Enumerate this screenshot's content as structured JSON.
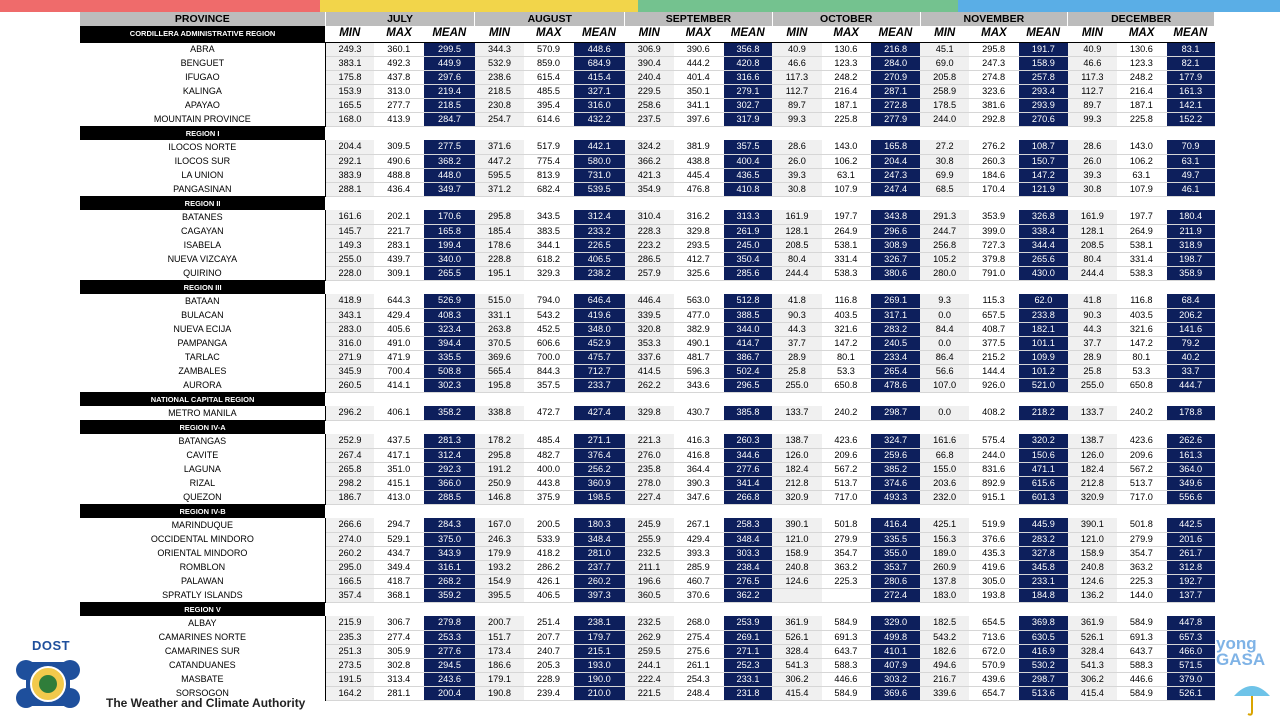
{
  "colors": {
    "top_bar": [
      "#ef6b6b",
      "#f2d54a",
      "#74c28f",
      "#5aaee6"
    ],
    "header_gray": "#bcbcbc",
    "mean_fill": "#0d1f5c",
    "region_fill": "#000000"
  },
  "header": {
    "province": "PROVINCE",
    "months": [
      "JULY",
      "AUGUST",
      "SEPTEMBER",
      "OCTOBER",
      "NOVEMBER",
      "DECEMBER"
    ],
    "sub": [
      "MIN",
      "MAX",
      "MEAN"
    ]
  },
  "footer": {
    "dost": "DOST",
    "tagline": "The Weather and Climate Authority",
    "pagasa_1": "yong",
    "pagasa_2": "GASA"
  },
  "regions": [
    {
      "name": "CORDILLERA ADMINISTRATIVE REGION",
      "provinces": [
        {
          "name": "ABRA",
          "v": [
            "249.3",
            "360.1",
            "299.5",
            "344.3",
            "570.9",
            "448.6",
            "306.9",
            "390.6",
            "356.8",
            "40.9",
            "130.6",
            "216.8",
            "45.1",
            "295.8",
            "191.7",
            "40.9",
            "130.6",
            "83.1"
          ]
        },
        {
          "name": "BENGUET",
          "v": [
            "383.1",
            "492.3",
            "449.9",
            "532.9",
            "859.0",
            "684.9",
            "390.4",
            "444.2",
            "420.8",
            "46.6",
            "123.3",
            "284.0",
            "69.0",
            "247.3",
            "158.9",
            "46.6",
            "123.3",
            "82.1"
          ]
        },
        {
          "name": "IFUGAO",
          "v": [
            "175.8",
            "437.8",
            "297.6",
            "238.6",
            "615.4",
            "415.4",
            "240.4",
            "401.4",
            "316.6",
            "117.3",
            "248.2",
            "270.9",
            "205.8",
            "274.8",
            "257.8",
            "117.3",
            "248.2",
            "177.9"
          ]
        },
        {
          "name": "KALINGA",
          "v": [
            "153.9",
            "313.0",
            "219.4",
            "218.5",
            "485.5",
            "327.1",
            "229.5",
            "350.1",
            "279.1",
            "112.7",
            "216.4",
            "287.1",
            "258.9",
            "323.6",
            "293.4",
            "112.7",
            "216.4",
            "161.3"
          ]
        },
        {
          "name": "APAYAO",
          "v": [
            "165.5",
            "277.7",
            "218.5",
            "230.8",
            "395.4",
            "316.0",
            "258.6",
            "341.1",
            "302.7",
            "89.7",
            "187.1",
            "272.8",
            "178.5",
            "381.6",
            "293.9",
            "89.7",
            "187.1",
            "142.1"
          ]
        },
        {
          "name": "MOUNTAIN PROVINCE",
          "v": [
            "168.0",
            "413.9",
            "284.7",
            "254.7",
            "614.6",
            "432.2",
            "237.5",
            "397.6",
            "317.9",
            "99.3",
            "225.8",
            "277.9",
            "244.0",
            "292.8",
            "270.6",
            "99.3",
            "225.8",
            "152.2"
          ]
        }
      ]
    },
    {
      "name": "REGION I",
      "provinces": [
        {
          "name": "ILOCOS NORTE",
          "v": [
            "204.4",
            "309.5",
            "277.5",
            "371.6",
            "517.9",
            "442.1",
            "324.2",
            "381.9",
            "357.5",
            "28.6",
            "143.0",
            "165.8",
            "27.2",
            "276.2",
            "108.7",
            "28.6",
            "143.0",
            "70.9"
          ]
        },
        {
          "name": "ILOCOS SUR",
          "v": [
            "292.1",
            "490.6",
            "368.2",
            "447.2",
            "775.4",
            "580.0",
            "366.2",
            "438.8",
            "400.4",
            "26.0",
            "106.2",
            "204.4",
            "30.8",
            "260.3",
            "150.7",
            "26.0",
            "106.2",
            "63.1"
          ]
        },
        {
          "name": "LA UNION",
          "v": [
            "383.9",
            "488.8",
            "448.0",
            "595.5",
            "813.9",
            "731.0",
            "421.3",
            "445.4",
            "436.5",
            "39.3",
            "63.1",
            "247.3",
            "69.9",
            "184.6",
            "147.2",
            "39.3",
            "63.1",
            "49.7"
          ]
        },
        {
          "name": "PANGASINAN",
          "v": [
            "288.1",
            "436.4",
            "349.7",
            "371.2",
            "682.4",
            "539.5",
            "354.9",
            "476.8",
            "410.8",
            "30.8",
            "107.9",
            "247.4",
            "68.5",
            "170.4",
            "121.9",
            "30.8",
            "107.9",
            "46.1"
          ]
        }
      ]
    },
    {
      "name": "REGION II",
      "provinces": [
        {
          "name": "BATANES",
          "v": [
            "161.6",
            "202.1",
            "170.6",
            "295.8",
            "343.5",
            "312.4",
            "310.4",
            "316.2",
            "313.3",
            "161.9",
            "197.7",
            "343.8",
            "291.3",
            "353.9",
            "326.8",
            "161.9",
            "197.7",
            "180.4"
          ]
        },
        {
          "name": "CAGAYAN",
          "v": [
            "145.7",
            "221.7",
            "165.8",
            "185.4",
            "383.5",
            "233.2",
            "228.3",
            "329.8",
            "261.9",
            "128.1",
            "264.9",
            "296.6",
            "244.7",
            "399.0",
            "338.4",
            "128.1",
            "264.9",
            "211.9"
          ]
        },
        {
          "name": "ISABELA",
          "v": [
            "149.3",
            "283.1",
            "199.4",
            "178.6",
            "344.1",
            "226.5",
            "223.2",
            "293.5",
            "245.0",
            "208.5",
            "538.1",
            "308.9",
            "256.8",
            "727.3",
            "344.4",
            "208.5",
            "538.1",
            "318.9"
          ]
        },
        {
          "name": "NUEVA VIZCAYA",
          "v": [
            "255.0",
            "439.7",
            "340.0",
            "228.8",
            "618.2",
            "406.5",
            "286.5",
            "412.7",
            "350.4",
            "80.4",
            "331.4",
            "326.7",
            "105.2",
            "379.8",
            "265.6",
            "80.4",
            "331.4",
            "198.7"
          ]
        },
        {
          "name": "QUIRINO",
          "v": [
            "228.0",
            "309.1",
            "265.5",
            "195.1",
            "329.3",
            "238.2",
            "257.9",
            "325.6",
            "285.6",
            "244.4",
            "538.3",
            "380.6",
            "280.0",
            "791.0",
            "430.0",
            "244.4",
            "538.3",
            "358.9"
          ]
        }
      ]
    },
    {
      "name": "REGION III",
      "provinces": [
        {
          "name": "BATAAN",
          "v": [
            "418.9",
            "644.3",
            "526.9",
            "515.0",
            "794.0",
            "646.4",
            "446.4",
            "563.0",
            "512.8",
            "41.8",
            "116.8",
            "269.1",
            "9.3",
            "115.3",
            "62.0",
            "41.8",
            "116.8",
            "68.4"
          ]
        },
        {
          "name": "BULACAN",
          "v": [
            "343.1",
            "429.4",
            "408.3",
            "331.1",
            "543.2",
            "419.6",
            "339.5",
            "477.0",
            "388.5",
            "90.3",
            "403.5",
            "317.1",
            "0.0",
            "657.5",
            "233.8",
            "90.3",
            "403.5",
            "206.2"
          ]
        },
        {
          "name": "NUEVA ECIJA",
          "v": [
            "283.0",
            "405.6",
            "323.4",
            "263.8",
            "452.5",
            "348.0",
            "320.8",
            "382.9",
            "344.0",
            "44.3",
            "321.6",
            "283.2",
            "84.4",
            "408.7",
            "182.1",
            "44.3",
            "321.6",
            "141.6"
          ]
        },
        {
          "name": "PAMPANGA",
          "v": [
            "316.0",
            "491.0",
            "394.4",
            "370.5",
            "606.6",
            "452.9",
            "353.3",
            "490.1",
            "414.7",
            "37.7",
            "147.2",
            "240.5",
            "0.0",
            "377.5",
            "101.1",
            "37.7",
            "147.2",
            "79.2"
          ]
        },
        {
          "name": "TARLAC",
          "v": [
            "271.9",
            "471.9",
            "335.5",
            "369.6",
            "700.0",
            "475.7",
            "337.6",
            "481.7",
            "386.7",
            "28.9",
            "80.1",
            "233.4",
            "86.4",
            "215.2",
            "109.9",
            "28.9",
            "80.1",
            "40.2"
          ]
        },
        {
          "name": "ZAMBALES",
          "v": [
            "345.9",
            "700.4",
            "508.8",
            "565.4",
            "844.3",
            "712.7",
            "414.5",
            "596.3",
            "502.4",
            "25.8",
            "53.3",
            "265.4",
            "56.6",
            "144.4",
            "101.2",
            "25.8",
            "53.3",
            "33.7"
          ]
        },
        {
          "name": "AURORA",
          "v": [
            "260.5",
            "414.1",
            "302.3",
            "195.8",
            "357.5",
            "233.7",
            "262.2",
            "343.6",
            "296.5",
            "255.0",
            "650.8",
            "478.6",
            "107.0",
            "926.0",
            "521.0",
            "255.0",
            "650.8",
            "444.7"
          ]
        }
      ]
    },
    {
      "name": "NATIONAL CAPITAL REGION",
      "provinces": [
        {
          "name": "METRO MANILA",
          "v": [
            "296.2",
            "406.1",
            "358.2",
            "338.8",
            "472.7",
            "427.4",
            "329.8",
            "430.7",
            "385.8",
            "133.7",
            "240.2",
            "298.7",
            "0.0",
            "408.2",
            "218.2",
            "133.7",
            "240.2",
            "178.8"
          ]
        }
      ]
    },
    {
      "name": "REGION IV-A",
      "provinces": [
        {
          "name": "BATANGAS",
          "v": [
            "252.9",
            "437.5",
            "281.3",
            "178.2",
            "485.4",
            "271.1",
            "221.3",
            "416.3",
            "260.3",
            "138.7",
            "423.6",
            "324.7",
            "161.6",
            "575.4",
            "320.2",
            "138.7",
            "423.6",
            "262.6"
          ]
        },
        {
          "name": "CAVITE",
          "v": [
            "267.4",
            "417.1",
            "312.4",
            "295.8",
            "482.7",
            "376.4",
            "276.0",
            "416.8",
            "344.6",
            "126.0",
            "209.6",
            "259.6",
            "66.8",
            "244.0",
            "150.6",
            "126.0",
            "209.6",
            "161.3"
          ]
        },
        {
          "name": "LAGUNA",
          "v": [
            "265.8",
            "351.0",
            "292.3",
            "191.2",
            "400.0",
            "256.2",
            "235.8",
            "364.4",
            "277.6",
            "182.4",
            "567.2",
            "385.2",
            "155.0",
            "831.6",
            "471.1",
            "182.4",
            "567.2",
            "364.0"
          ]
        },
        {
          "name": "RIZAL",
          "v": [
            "298.2",
            "415.1",
            "366.0",
            "250.9",
            "443.8",
            "360.9",
            "278.0",
            "390.3",
            "341.4",
            "212.8",
            "513.7",
            "374.6",
            "203.6",
            "892.9",
            "615.6",
            "212.8",
            "513.7",
            "349.6"
          ]
        },
        {
          "name": "QUEZON",
          "v": [
            "186.7",
            "413.0",
            "288.5",
            "146.8",
            "375.9",
            "198.5",
            "227.4",
            "347.6",
            "266.8",
            "320.9",
            "717.0",
            "493.3",
            "232.0",
            "915.1",
            "601.3",
            "320.9",
            "717.0",
            "556.6"
          ]
        }
      ]
    },
    {
      "name": "REGION IV-B",
      "provinces": [
        {
          "name": "MARINDUQUE",
          "v": [
            "266.6",
            "294.7",
            "284.3",
            "167.0",
            "200.5",
            "180.3",
            "245.9",
            "267.1",
            "258.3",
            "390.1",
            "501.8",
            "416.4",
            "425.1",
            "519.9",
            "445.9",
            "390.1",
            "501.8",
            "442.5"
          ]
        },
        {
          "name": "OCCIDENTAL MINDORO",
          "v": [
            "274.0",
            "529.1",
            "375.0",
            "246.3",
            "533.9",
            "348.4",
            "255.9",
            "429.4",
            "348.4",
            "121.0",
            "279.9",
            "335.5",
            "156.3",
            "376.6",
            "283.2",
            "121.0",
            "279.9",
            "201.6"
          ]
        },
        {
          "name": "ORIENTAL MINDORO",
          "v": [
            "260.2",
            "434.7",
            "343.9",
            "179.9",
            "418.2",
            "281.0",
            "232.5",
            "393.3",
            "303.3",
            "158.9",
            "354.7",
            "355.0",
            "189.0",
            "435.3",
            "327.8",
            "158.9",
            "354.7",
            "261.7"
          ]
        },
        {
          "name": "ROMBLON",
          "v": [
            "295.0",
            "349.4",
            "316.1",
            "193.2",
            "286.2",
            "237.7",
            "211.1",
            "285.9",
            "238.4",
            "240.8",
            "363.2",
            "353.7",
            "260.9",
            "419.6",
            "345.8",
            "240.8",
            "363.2",
            "312.8"
          ]
        },
        {
          "name": "PALAWAN",
          "v": [
            "166.5",
            "418.7",
            "268.2",
            "154.9",
            "426.1",
            "260.2",
            "196.6",
            "460.7",
            "276.5",
            "124.6",
            "225.3",
            "280.6",
            "137.8",
            "305.0",
            "233.1",
            "124.6",
            "225.3",
            "192.7"
          ]
        },
        {
          "name": "SPRATLY ISLANDS",
          "v": [
            "357.4",
            "368.1",
            "359.2",
            "395.5",
            "406.5",
            "397.3",
            "360.5",
            "370.6",
            "362.2",
            "",
            "",
            "272.4",
            "183.0",
            "193.8",
            "184.8",
            "136.2",
            "144.0",
            "137.7"
          ]
        }
      ]
    },
    {
      "name": "REGION V",
      "provinces": [
        {
          "name": "ALBAY",
          "v": [
            "215.9",
            "306.7",
            "279.8",
            "200.7",
            "251.4",
            "238.1",
            "232.5",
            "268.0",
            "253.9",
            "361.9",
            "584.9",
            "329.0",
            "182.5",
            "654.5",
            "369.8",
            "361.9",
            "584.9",
            "447.8"
          ]
        },
        {
          "name": "CAMARINES NORTE",
          "v": [
            "235.3",
            "277.4",
            "253.3",
            "151.7",
            "207.7",
            "179.7",
            "262.9",
            "275.4",
            "269.1",
            "526.1",
            "691.3",
            "499.8",
            "543.2",
            "713.6",
            "630.5",
            "526.1",
            "691.3",
            "657.3"
          ]
        },
        {
          "name": "CAMARINES SUR",
          "v": [
            "251.3",
            "305.9",
            "277.6",
            "173.4",
            "240.7",
            "215.1",
            "259.5",
            "275.6",
            "271.1",
            "328.4",
            "643.7",
            "410.1",
            "182.6",
            "672.0",
            "416.9",
            "328.4",
            "643.7",
            "466.0"
          ]
        },
        {
          "name": "CATANDUANES",
          "v": [
            "273.5",
            "302.8",
            "294.5",
            "186.6",
            "205.3",
            "193.0",
            "244.1",
            "261.1",
            "252.3",
            "541.3",
            "588.3",
            "407.9",
            "494.6",
            "570.9",
            "530.2",
            "541.3",
            "588.3",
            "571.5"
          ]
        },
        {
          "name": "MASBATE",
          "v": [
            "191.5",
            "313.4",
            "243.6",
            "179.1",
            "228.9",
            "190.0",
            "222.4",
            "254.3",
            "233.1",
            "306.2",
            "446.6",
            "303.2",
            "216.7",
            "439.6",
            "298.7",
            "306.2",
            "446.6",
            "379.0"
          ]
        },
        {
          "name": "SORSOGON",
          "v": [
            "164.2",
            "281.1",
            "200.4",
            "190.8",
            "239.4",
            "210.0",
            "221.5",
            "248.4",
            "231.8",
            "415.4",
            "584.9",
            "369.6",
            "339.6",
            "654.7",
            "513.6",
            "415.4",
            "584.9",
            "526.1"
          ]
        }
      ]
    }
  ]
}
